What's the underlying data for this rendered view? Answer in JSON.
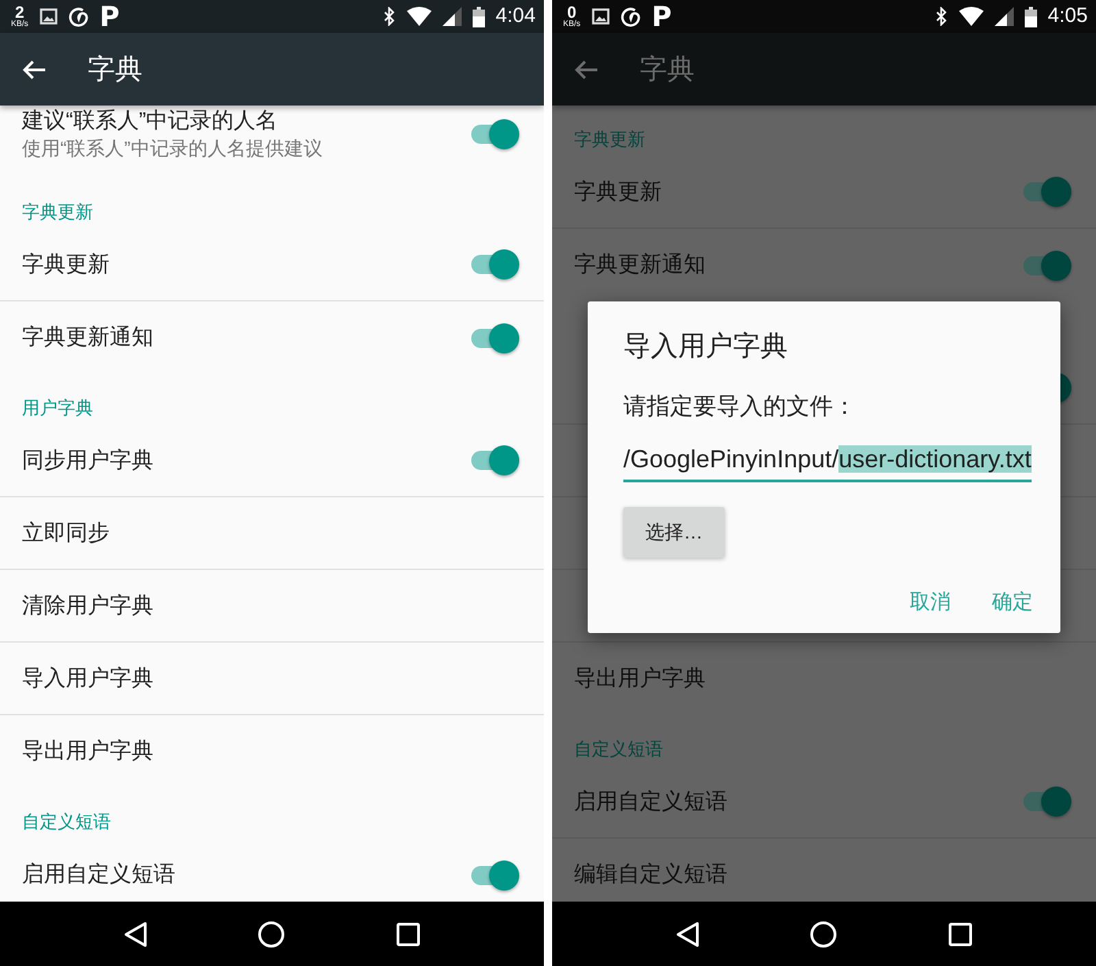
{
  "screens": [
    {
      "status_bar": {
        "speed": "2",
        "speed_unit": "KB/s",
        "app_letter": "P",
        "time": "4:04"
      },
      "toolbar": {
        "title": "字典"
      },
      "items": [
        {
          "kind": "setting",
          "title": "建议“联系人”中记录的人名",
          "summary": "使用“联系人”中记录的人名提供建议",
          "on": true,
          "cut_top": true
        },
        {
          "kind": "category",
          "title": "字典更新"
        },
        {
          "kind": "setting",
          "title": "字典更新",
          "on": true
        },
        {
          "kind": "setting",
          "title": "字典更新通知",
          "on": true
        },
        {
          "kind": "category",
          "title": "用户字典"
        },
        {
          "kind": "setting",
          "title": "同步用户字典",
          "on": true
        },
        {
          "kind": "setting",
          "title": "立即同步"
        },
        {
          "kind": "setting",
          "title": "清除用户字典"
        },
        {
          "kind": "setting",
          "title": "导入用户字典"
        },
        {
          "kind": "setting",
          "title": "导出用户字典"
        },
        {
          "kind": "category",
          "title": "自定义短语"
        },
        {
          "kind": "setting",
          "title": "启用自定义短语",
          "on": true
        }
      ]
    },
    {
      "status_bar": {
        "speed": "0",
        "speed_unit": "KB/s",
        "app_letter": "P",
        "time": "4:05"
      },
      "toolbar": {
        "title": "字典"
      },
      "items": [
        {
          "kind": "category",
          "title": "字典更新"
        },
        {
          "kind": "setting",
          "title": "字典更新",
          "on": true
        },
        {
          "kind": "setting",
          "title": "字典更新通知",
          "on": true
        },
        {
          "kind": "category"
        },
        {
          "kind": "setting",
          "on": true
        },
        {
          "kind": "setting"
        },
        {
          "kind": "setting"
        },
        {
          "kind": "setting"
        },
        {
          "kind": "setting",
          "title": "导出用户字典"
        },
        {
          "kind": "category",
          "title": "自定义短语"
        },
        {
          "kind": "setting",
          "title": "启用自定义短语",
          "on": true
        },
        {
          "kind": "setting",
          "title": "编辑自定义短语"
        }
      ],
      "dialog": {
        "title": "导入用户字典",
        "message": "请指定要导入的文件：",
        "field": {
          "value": "/GooglePinyinInput/",
          "selected_text": "user-dictionary.txt"
        },
        "choose_button": "选择…",
        "actions": [
          "取消",
          "确定"
        ]
      }
    }
  ]
}
